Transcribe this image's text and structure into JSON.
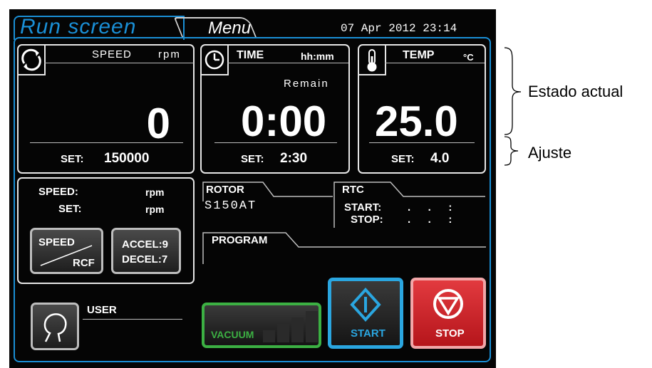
{
  "header": {
    "tab_run": "Run screen",
    "tab_menu": "Menu",
    "datetime": "07 Apr 2012 23:14"
  },
  "speed_panel": {
    "title": "SPEED",
    "unit": "rpm",
    "value": "0",
    "set_label": "SET:",
    "set_value": "150000",
    "icon": "rotation-arrows-icon"
  },
  "time_panel": {
    "title": "TIME",
    "unit": "hh:mm",
    "remain_label": "Remain",
    "value": "0:00",
    "set_label": "SET:",
    "set_value": "2:30",
    "icon": "clock-icon"
  },
  "temp_panel": {
    "title": "TEMP",
    "unit": "°C",
    "value": "25.0",
    "set_label": "SET:",
    "set_value": "4.0",
    "icon": "thermometer-icon"
  },
  "info_panel": {
    "speed_label": "SPEED:",
    "speed_unit": "rpm",
    "set_label": "SET:",
    "set_unit": "rpm",
    "speed_rcf_top": "SPEED",
    "speed_rcf_bottom": "RCF",
    "accel": "ACCEL:9",
    "decel": "DECEL:7"
  },
  "rotor": {
    "label": "ROTOR",
    "value": "S150AT"
  },
  "rtc": {
    "label": "RTC",
    "start_label": "START:",
    "stop_label": "STOP:",
    "start_value": ".   .   :",
    "stop_value": ".   .   :"
  },
  "program": {
    "label": "PROGRAM"
  },
  "user": {
    "label": "USER",
    "icon": "user-head-icon"
  },
  "buttons": {
    "vacuum": "VACUUM",
    "start": "START",
    "stop": "STOP"
  },
  "annotations": {
    "estado": "Estado actual",
    "ajuste": "Ajuste"
  },
  "colors": {
    "accent_blue": "#1a8fd6",
    "vacuum_green": "#3cb043",
    "start_blue": "#2aa6e0",
    "stop_red": "#d8262c"
  }
}
